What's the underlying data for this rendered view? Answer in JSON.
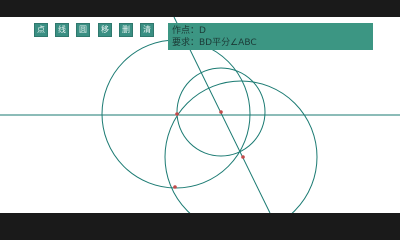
{
  "toolbar": {
    "tools": [
      {
        "name": "tool-point",
        "label": "点"
      },
      {
        "name": "tool-line",
        "label": "线"
      },
      {
        "name": "tool-circle",
        "label": "圆"
      },
      {
        "name": "tool-move",
        "label": "移"
      },
      {
        "name": "tool-undo",
        "label": "删"
      },
      {
        "name": "tool-clear",
        "label": "清"
      }
    ]
  },
  "info_panel": {
    "line1": "作点：D",
    "line2": "要求：BD平分∠ABC"
  },
  "colors": {
    "construction": "#1a7a72",
    "point": "#c24a4a",
    "panel": "#3c9683"
  }
}
